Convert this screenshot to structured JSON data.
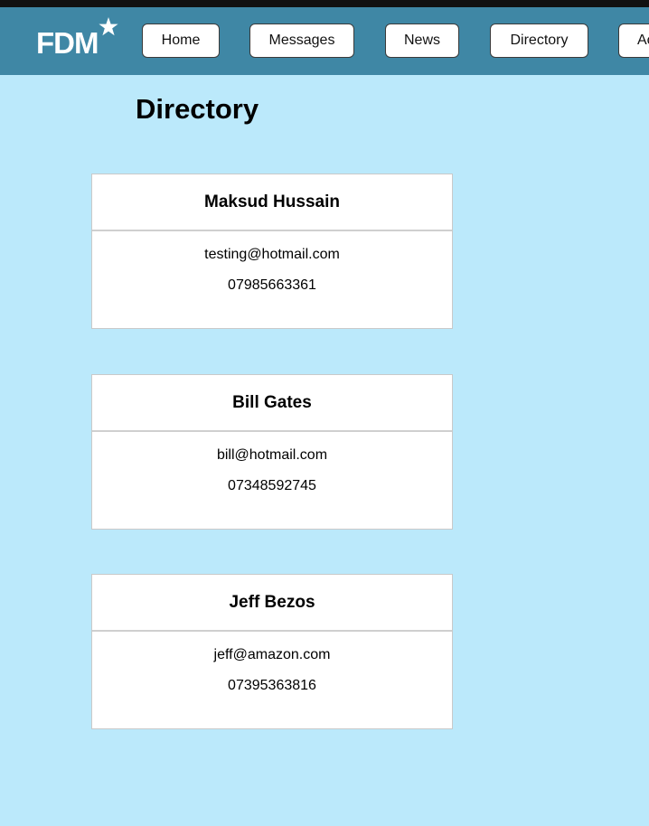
{
  "brand": {
    "name": "FDM"
  },
  "nav": {
    "items": [
      {
        "label": "Home"
      },
      {
        "label": "Messages"
      },
      {
        "label": "News"
      },
      {
        "label": "Directory"
      },
      {
        "label": "Ac"
      }
    ]
  },
  "page": {
    "title": "Directory"
  },
  "contacts": [
    {
      "name": "Maksud Hussain",
      "email": "testing@hotmail.com",
      "phone": "07985663361"
    },
    {
      "name": "Bill Gates",
      "email": "bill@hotmail.com",
      "phone": "07348592745"
    },
    {
      "name": "Jeff Bezos",
      "email": "jeff@amazon.com",
      "phone": "07395363816"
    }
  ],
  "colors": {
    "page_background": "#bbe9fb",
    "nav_background": "#3f87a5",
    "card_background": "#ffffff"
  }
}
